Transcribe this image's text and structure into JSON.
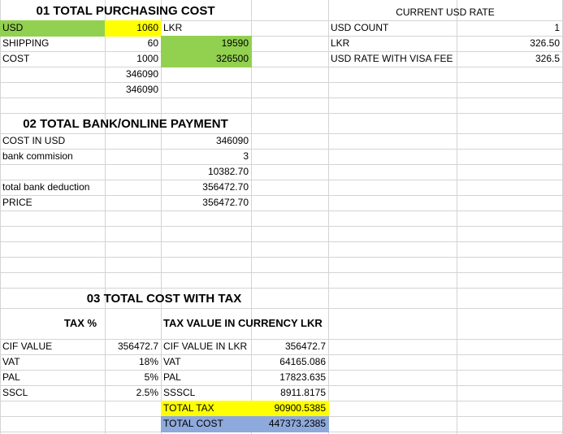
{
  "colors": {
    "green": "#92d050",
    "yellow": "#ffff00",
    "blue": "#8ea9db",
    "gridline": "#d4d4d4"
  },
  "section1": {
    "title": "01 TOTAL PURCHASING COST",
    "usd_label": "USD",
    "usd_value": "1060",
    "lkr_label": "LKR",
    "shipping_label": "SHIPPING",
    "shipping_value": "60",
    "shipping_lkr": "19590",
    "cost_label": "COST",
    "cost_value": "1000",
    "cost_lkr": "326500",
    "extra1": "346090",
    "extra2": "346090"
  },
  "rate": {
    "title": "CURRENT USD RATE",
    "usd_count_label": "USD COUNT",
    "usd_count_value": "1",
    "lkr_label": "LKR",
    "lkr_value": "326.50",
    "visa_label": "USD RATE WITH VISA FEE",
    "visa_value": "326.5"
  },
  "section2": {
    "title": "02 TOTAL BANK/ONLINE PAYMENT",
    "cost_usd_label": "COST IN USD",
    "cost_usd_value": "346090",
    "commission_label": "bank commision",
    "commission_value": "3",
    "deduction_calc": "10382.70",
    "deduction_label": "total bank deduction",
    "deduction_value": "356472.70",
    "price_label": "PRICE",
    "price_value": "356472.70"
  },
  "section3": {
    "title": "03 TOTAL COST WITH TAX",
    "tax_pct_header": "TAX %",
    "tax_value_header": "TAX VALUE IN CURRENCY LKR",
    "cif_label": "CIF VALUE",
    "cif_value": "356472.7",
    "cif_lkr_label": "CIF VALUE IN LKR",
    "cif_lkr_value": "356472.7",
    "vat_label": "VAT",
    "vat_pct": "18%",
    "vat_label2": "VAT",
    "vat_value": "64165.086",
    "pal_label": "PAL",
    "pal_pct": "5%",
    "pal_label2": "PAL",
    "pal_value": "17823.635",
    "sscl_label": "SSCL",
    "sscl_pct": "2.5%",
    "sscl_label2": "SSSCL",
    "sscl_value": "8911.8175",
    "total_tax_label": "TOTAL TAX",
    "total_tax_value": "90900.5385",
    "total_cost_label": "TOTAL COST",
    "total_cost_value": "447373.2385"
  }
}
